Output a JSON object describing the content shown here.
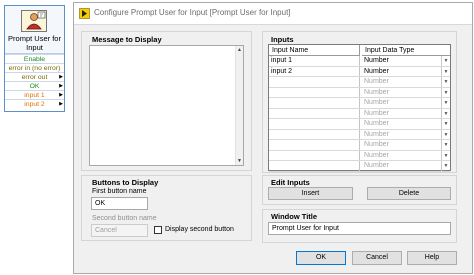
{
  "node": {
    "title_line1": "Prompt User for",
    "title_line2": "Input",
    "terminals": [
      {
        "label": "Enable",
        "color": "#1d8a1d"
      },
      {
        "label": "error in (no error)",
        "color": "#7a6a00"
      },
      {
        "label": "error out",
        "color": "#7a6a00"
      },
      {
        "label": "OK",
        "color": "#1d8a1d"
      },
      {
        "label": "input 1",
        "color": "#e07000"
      },
      {
        "label": "input 2",
        "color": "#e07000"
      }
    ]
  },
  "dialog": {
    "title": "Configure Prompt User for Input [Prompt User for Input]",
    "message_section": {
      "title": "Message to Display",
      "value": ""
    },
    "buttons_section": {
      "title": "Buttons to Display",
      "first_label": "First button name",
      "first_value": "OK",
      "second_label": "Second button name",
      "second_value": "Cancel",
      "checkbox_label": "Display second button",
      "checkbox_checked": false
    },
    "inputs_section": {
      "title": "Inputs",
      "col_name": "Input Name",
      "col_type": "Input Data Type",
      "rows": [
        {
          "name": "input 1",
          "type": "Number"
        },
        {
          "name": "input 2",
          "type": "Number"
        },
        {
          "name": "",
          "type": "Number"
        },
        {
          "name": "",
          "type": "Number"
        },
        {
          "name": "",
          "type": "Number"
        },
        {
          "name": "",
          "type": "Number"
        },
        {
          "name": "",
          "type": "Number"
        },
        {
          "name": "",
          "type": "Number"
        },
        {
          "name": "",
          "type": "Number"
        },
        {
          "name": "",
          "type": "Number"
        },
        {
          "name": "",
          "type": "Number"
        }
      ]
    },
    "edit_section": {
      "title": "Edit Inputs",
      "insert": "Insert",
      "delete": "Delete"
    },
    "window_section": {
      "title": "Window Title",
      "value": "Prompt User for Input"
    },
    "buttons": {
      "ok": "OK",
      "cancel": "Cancel",
      "help": "Help"
    }
  }
}
